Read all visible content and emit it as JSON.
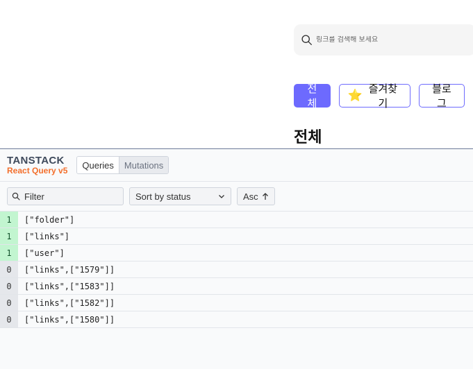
{
  "app": {
    "search": {
      "placeholder": "링크를 검색해 보세요"
    },
    "folders": [
      {
        "label": "전체",
        "active": true
      },
      {
        "label": "즐겨찾기",
        "active": false,
        "icon": "star-icon"
      },
      {
        "label": "블로그",
        "active": false
      }
    ],
    "current_folder_title": "전체",
    "colors": {
      "primary": "#6d6afe"
    }
  },
  "devtools": {
    "logo": {
      "top": "TANSTACK",
      "bottom": "React Query v5"
    },
    "tabs": [
      {
        "label": "Queries",
        "active": true
      },
      {
        "label": "Mutations",
        "active": false
      }
    ],
    "filter": {
      "placeholder": "Filter"
    },
    "sort": {
      "value": "Sort by status"
    },
    "order": {
      "label": "Asc"
    },
    "queries": [
      {
        "count": "1",
        "key": "[\"folder\"]",
        "status": "fresh"
      },
      {
        "count": "1",
        "key": "[\"links\"]",
        "status": "fresh"
      },
      {
        "count": "1",
        "key": "[\"user\"]",
        "status": "fresh"
      },
      {
        "count": "0",
        "key": "[\"links\",[\"1579\"]]",
        "status": "inactive"
      },
      {
        "count": "0",
        "key": "[\"links\",[\"1583\"]]",
        "status": "inactive"
      },
      {
        "count": "0",
        "key": "[\"links\",[\"1582\"]]",
        "status": "inactive"
      },
      {
        "count": "0",
        "key": "[\"links\",[\"1580\"]]",
        "status": "inactive"
      }
    ],
    "colors": {
      "fresh": "#c2f5d0",
      "inactive": "#e5e7eb",
      "accent": "#f36f2c"
    }
  }
}
